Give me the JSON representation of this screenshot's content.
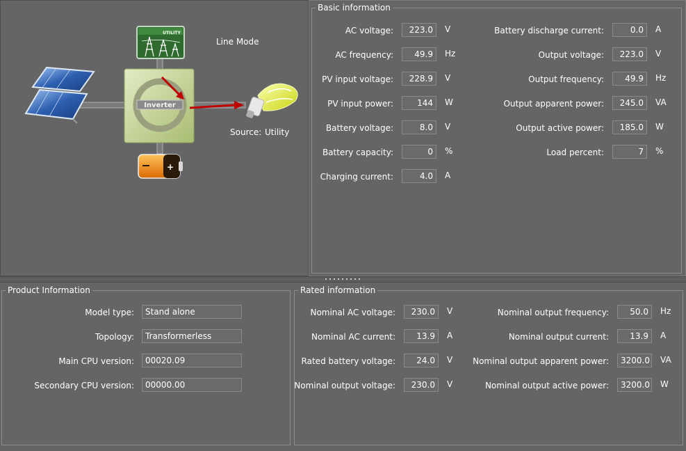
{
  "status": {
    "mode": "Line Mode",
    "source_label": "Source:",
    "source_value": "Utility"
  },
  "diagram": {
    "utility_label": "UTILITY",
    "inverter_label": "Inverter",
    "battery_symbol": "+"
  },
  "basic": {
    "title": "Basic information",
    "left": [
      {
        "label": "AC voltage:",
        "value": "223.0",
        "unit": "V"
      },
      {
        "label": "AC frequency:",
        "value": "49.9",
        "unit": "Hz"
      },
      {
        "label": "PV input voltage:",
        "value": "228.9",
        "unit": "V"
      },
      {
        "label": "PV input power:",
        "value": "144",
        "unit": "W"
      },
      {
        "label": "Battery voltage:",
        "value": "8.0",
        "unit": "V"
      },
      {
        "label": "Battery capacity:",
        "value": "0",
        "unit": "%"
      },
      {
        "label": "Charging current:",
        "value": "4.0",
        "unit": "A"
      }
    ],
    "right": [
      {
        "label": "Battery discharge current:",
        "value": "0.0",
        "unit": "A"
      },
      {
        "label": "Output voltage:",
        "value": "223.0",
        "unit": "V"
      },
      {
        "label": "Output frequency:",
        "value": "49.9",
        "unit": "Hz"
      },
      {
        "label": "Output apparent power:",
        "value": "245.0",
        "unit": "VA"
      },
      {
        "label": "Output active power:",
        "value": "185.0",
        "unit": "W"
      },
      {
        "label": "Load percent:",
        "value": "7",
        "unit": "%"
      }
    ]
  },
  "product": {
    "title": "Product Information",
    "rows": [
      {
        "label": "Model type:",
        "value": "Stand alone"
      },
      {
        "label": "Topology:",
        "value": "Transformerless"
      },
      {
        "label": "Main CPU version:",
        "value": "00020.09"
      },
      {
        "label": "Secondary CPU version:",
        "value": "00000.00"
      }
    ]
  },
  "rated": {
    "title": "Rated information",
    "left": [
      {
        "label": "Nominal AC voltage:",
        "value": "230.0",
        "unit": "V"
      },
      {
        "label": "Nominal AC current:",
        "value": "13.9",
        "unit": "A"
      },
      {
        "label": "Rated battery voltage:",
        "value": "24.0",
        "unit": "V"
      },
      {
        "label": "Nominal output voltage:",
        "value": "230.0",
        "unit": "V"
      }
    ],
    "right": [
      {
        "label": "Nominal output frequency:",
        "value": "50.0",
        "unit": "Hz"
      },
      {
        "label": "Nominal output current:",
        "value": "13.9",
        "unit": "A"
      },
      {
        "label": "Nominal output apparent power:",
        "value": "3200.0",
        "unit": "VA"
      },
      {
        "label": "Nominal output active power:",
        "value": "3200.0",
        "unit": "W"
      }
    ]
  },
  "colors": {
    "background": "#656565",
    "arrow": "#c00000",
    "solar_panel": "#2d5fb0",
    "utility_box": "#2f6b2f",
    "inverter": "#c6d69a",
    "battery": "#f08a00",
    "bulb": "#e6ef2a"
  }
}
